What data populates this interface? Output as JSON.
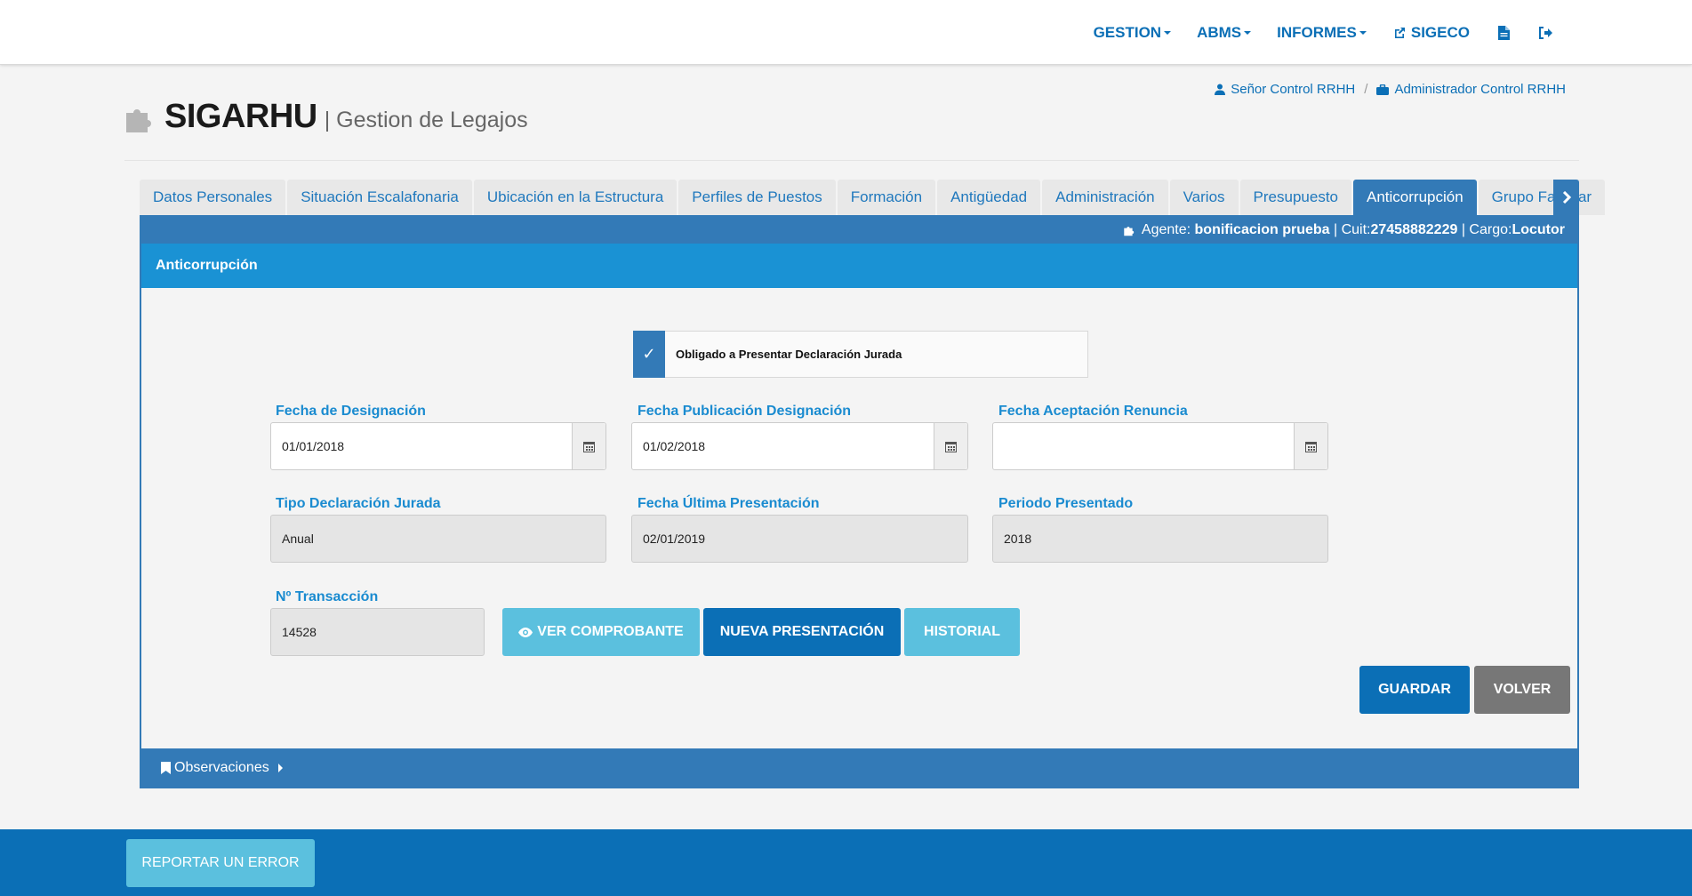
{
  "navbar": {
    "items": [
      {
        "label": "GESTION",
        "dropdown": true
      },
      {
        "label": "ABMS",
        "dropdown": true
      },
      {
        "label": "INFORMES",
        "dropdown": true
      }
    ],
    "sigeco_label": "SIGECO",
    "icons": [
      "external-link-icon",
      "document-icon",
      "logout-icon"
    ]
  },
  "breadcrumb": {
    "user": "Señor Control RRHH",
    "separator": "/",
    "role": "Administrador Control RRHH"
  },
  "header": {
    "title": "SIGARHU",
    "subtitle": "| Gestion de Legajos"
  },
  "tabs": [
    {
      "label": "Datos Personales",
      "active": false
    },
    {
      "label": "Situación Escalafonaria",
      "active": false
    },
    {
      "label": "Ubicación en la Estructura",
      "active": false
    },
    {
      "label": "Perfiles de Puestos",
      "active": false
    },
    {
      "label": "Formación",
      "active": false
    },
    {
      "label": "Antigüedad",
      "active": false
    },
    {
      "label": "Administración",
      "active": false
    },
    {
      "label": "Varios",
      "active": false
    },
    {
      "label": "Presupuesto",
      "active": false
    },
    {
      "label": "Anticorrupción",
      "active": true
    },
    {
      "label": "Grupo Familiar",
      "active": false
    }
  ],
  "agent": {
    "agent_label": "Agente:",
    "agent_name": "bonificacion prueba",
    "cuit_label": "| Cuit:",
    "cuit": "27458882229",
    "cargo_label": "| Cargo:",
    "cargo": "Locutor"
  },
  "section": {
    "title": "Anticorrupción"
  },
  "form": {
    "obligado": {
      "checked": true,
      "label": "Obligado a Presentar Declaración Jurada"
    },
    "fecha_designacion": {
      "label": "Fecha de Designación",
      "value": "01/01/2018"
    },
    "fecha_publicacion": {
      "label": "Fecha Publicación Designación",
      "value": "01/02/2018"
    },
    "fecha_aceptacion": {
      "label": "Fecha Aceptación Renuncia",
      "value": ""
    },
    "tipo_declaracion": {
      "label": "Tipo Declaración Jurada",
      "value": "Anual"
    },
    "fecha_ultima": {
      "label": "Fecha Última Presentación",
      "value": "02/01/2019"
    },
    "periodo": {
      "label": "Periodo Presentado",
      "value": "2018"
    },
    "transaccion": {
      "label": "Nº Transacción",
      "value": "14528"
    }
  },
  "buttons": {
    "ver_comprobante": "VER COMPROBANTE",
    "nueva_presentacion": "NUEVA PRESENTACIÓN",
    "historial": "HISTORIAL",
    "guardar": "GUARDAR",
    "volver": "VOLVER",
    "reportar_error": "REPORTAR UN ERROR"
  },
  "observaciones": {
    "label": "Observaciones"
  },
  "colors": {
    "brand_blue": "#0b6fb6",
    "tab_active": "#337ab7",
    "section_header": "#1a92d4",
    "info": "#5bc0de",
    "label": "#1a8bd0"
  }
}
